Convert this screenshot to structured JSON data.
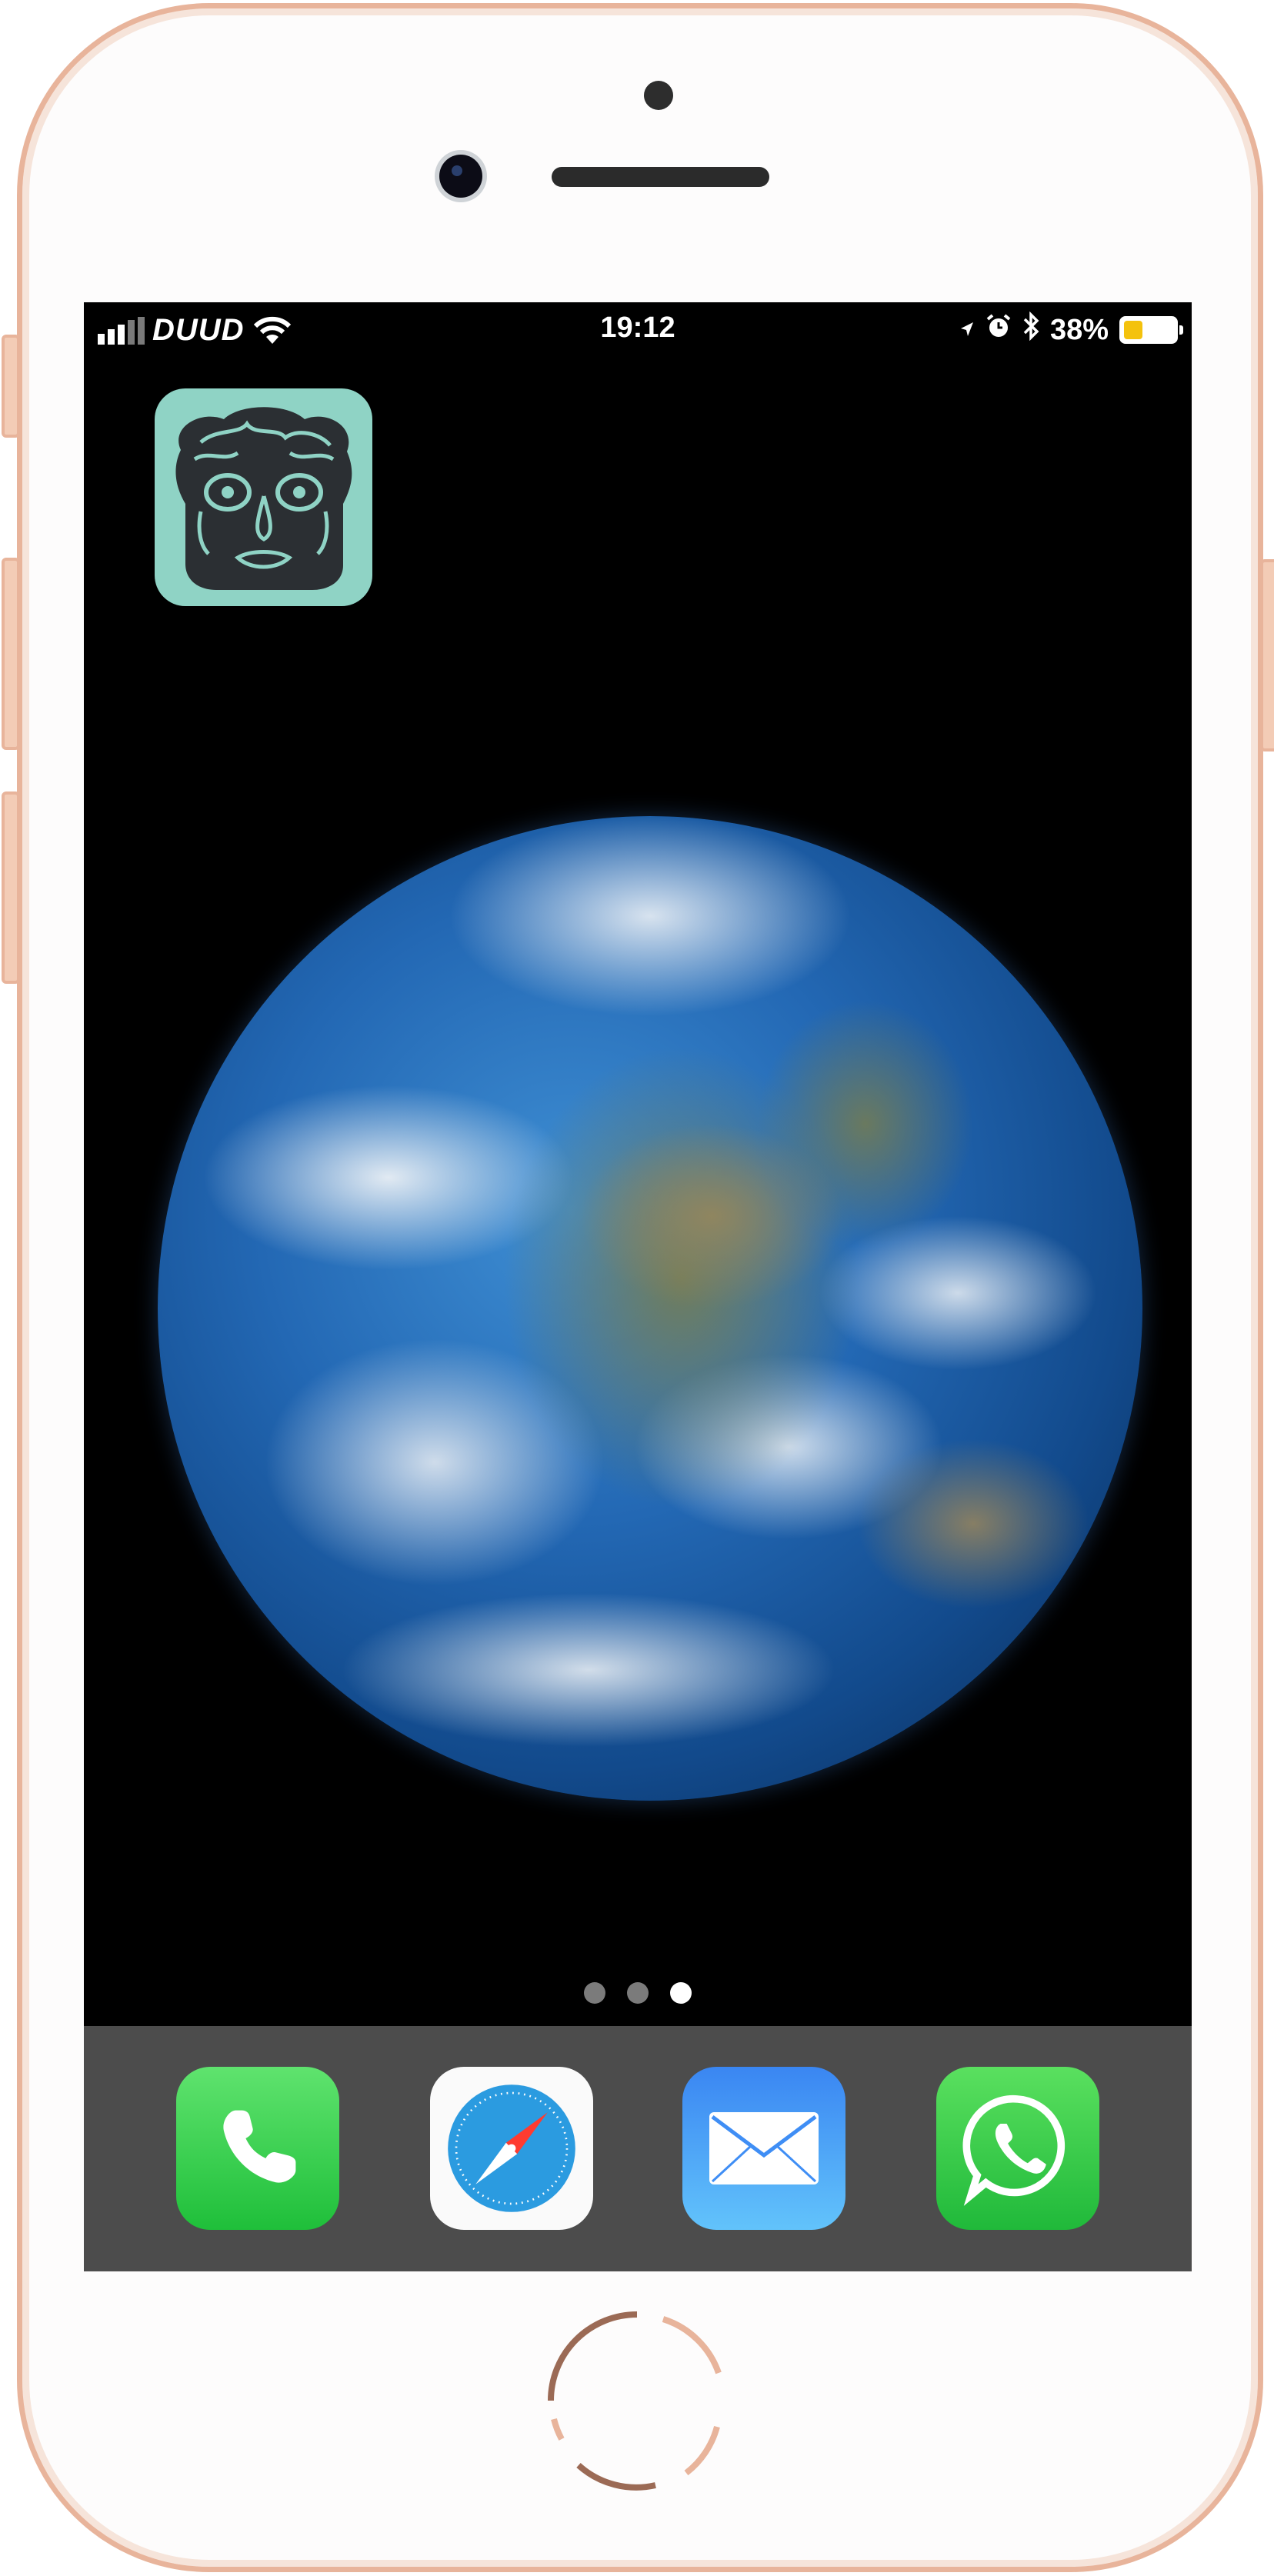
{
  "status_bar": {
    "carrier": "DUUD",
    "time": "19:12",
    "battery_percent": "38%",
    "battery_level": 0.38,
    "battery_color": "#f4c20d"
  },
  "home_screen": {
    "apps": [
      {
        "icon": "face-mask-app-icon",
        "color": "#8fd3c5"
      }
    ],
    "wallpaper": "earth-wallpaper",
    "page_dots": {
      "count": 3,
      "active": 3
    }
  },
  "dock": {
    "apps": [
      {
        "icon": "phone-icon",
        "color": "#34c94a"
      },
      {
        "icon": "safari-compass-icon",
        "color": "#2aa0d8"
      },
      {
        "icon": "mail-icon",
        "color": "#3f8ef5"
      },
      {
        "icon": "whatsapp-icon",
        "color": "#2fca45"
      }
    ]
  }
}
